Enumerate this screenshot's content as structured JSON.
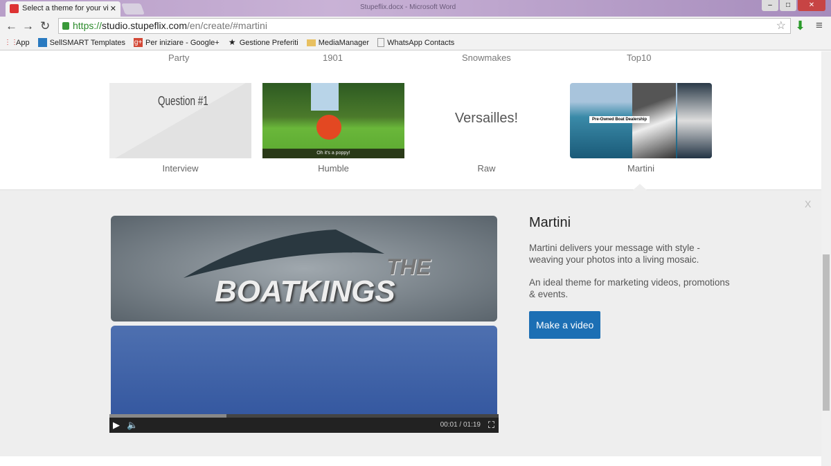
{
  "browser": {
    "tab_title": "Select a theme for your vi",
    "window_title": "Stupeflix.docx - Microsoft Word",
    "url_scheme": "https://",
    "url_host": "studio.stupeflix.com",
    "url_path": "/en/create/#martini"
  },
  "bookmarks": [
    {
      "label": "App",
      "icon": "apps-icon"
    },
    {
      "label": "SellSMART Templates",
      "icon": "site-icon"
    },
    {
      "label": "Per iniziare - Google+",
      "icon": "gplus-icon"
    },
    {
      "label": "Gestione Preferiti",
      "icon": "star-icon"
    },
    {
      "label": "MediaManager",
      "icon": "folder-icon"
    },
    {
      "label": "WhatsApp Contacts",
      "icon": "page-icon"
    }
  ],
  "previous_row": [
    "Party",
    "1901",
    "Snowmakes",
    "Top10"
  ],
  "themes": [
    {
      "name": "Interview",
      "thumb_text": "Question #1"
    },
    {
      "name": "Humble",
      "thumb_text": "Oh it's a poppy!"
    },
    {
      "name": "Raw",
      "thumb_text": "Versailles!"
    },
    {
      "name": "Martini",
      "thumb_text": "Pre-Owned Boat Dealership"
    }
  ],
  "detail": {
    "title": "Martini",
    "desc1": "Martini delivers your message with style - weaving your photos into a living mosaic.",
    "desc2": "An ideal theme for marketing videos, promotions & events.",
    "button": "Make a video",
    "close": "X"
  },
  "video": {
    "logo_the": "THE",
    "logo_text": "BOATKINGS",
    "time": "00:01 / 01:19",
    "progress": 0.03
  }
}
